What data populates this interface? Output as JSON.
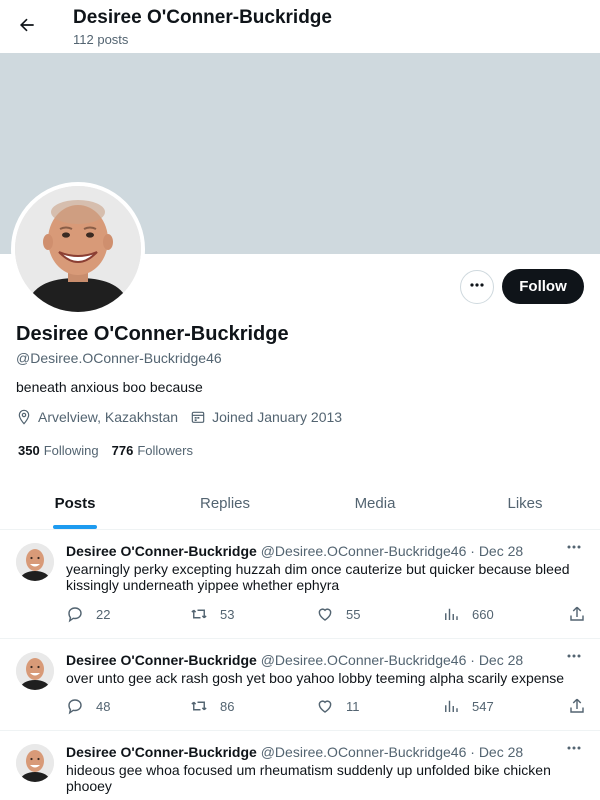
{
  "header": {
    "back_icon": "arrow-left-icon",
    "title": "Desiree O'Conner-Buckridge",
    "post_count": "112 posts"
  },
  "colors": {
    "banner": "#cfd9de",
    "accent": "#1d9bf0",
    "follow_bg": "#0f1419",
    "muted_text": "#536471"
  },
  "profile": {
    "name": "Desiree O'Conner-Buckridge",
    "handle": "@Desiree.OConner-Buckridge46",
    "bio": "beneath anxious boo because",
    "location": "Arvelview, Kazakhstan",
    "joined": "Joined January 2013",
    "following_count": "350",
    "following_label": "Following",
    "followers_count": "776",
    "followers_label": "Followers",
    "follow_label": "Follow",
    "more_icon": "more-horizontal-icon"
  },
  "tabs": [
    {
      "label": "Posts",
      "active": true
    },
    {
      "label": "Replies",
      "active": false
    },
    {
      "label": "Media",
      "active": false
    },
    {
      "label": "Likes",
      "active": false
    }
  ],
  "posts": [
    {
      "name": "Desiree O'Conner-Buckridge",
      "handle": "@Desiree.OConner-Buckridge46",
      "separator": "·",
      "date": "Dec 28",
      "text": "yearningly perky excepting huzzah dim once cauterize but quicker because bleed kissingly underneath yippee whether ephyra",
      "replies": "22",
      "reposts": "53",
      "likes": "55",
      "views": "660"
    },
    {
      "name": "Desiree O'Conner-Buckridge",
      "handle": "@Desiree.OConner-Buckridge46",
      "separator": "·",
      "date": "Dec 28",
      "text": "over unto gee ack rash gosh yet boo yahoo lobby teeming alpha scarily expense",
      "replies": "48",
      "reposts": "86",
      "likes": "11",
      "views": "547"
    },
    {
      "name": "Desiree O'Conner-Buckridge",
      "handle": "@Desiree.OConner-Buckridge46",
      "separator": "·",
      "date": "Dec 28",
      "text": "hideous gee whoa focused um rheumatism suddenly up unfolded bike chicken phooey"
    }
  ]
}
